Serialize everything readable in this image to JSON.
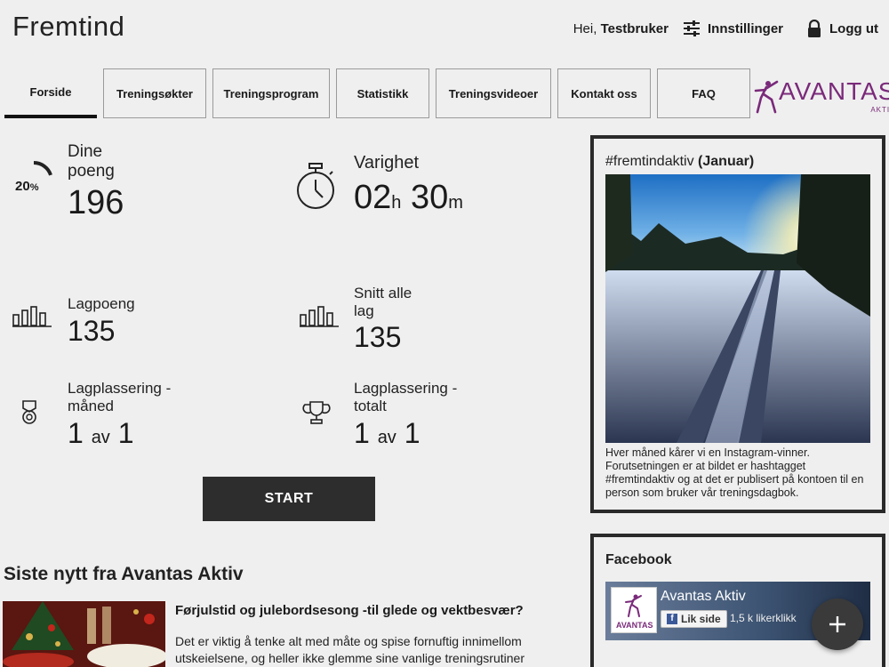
{
  "header": {
    "app_title": "Fremtind",
    "greeting_prefix": "Hei,",
    "user_name": "Testbruker",
    "settings_label": "Innstillinger",
    "logout_label": "Logg ut"
  },
  "nav": {
    "tabs": [
      {
        "label": "Forside",
        "active": true
      },
      {
        "label": "Treningsøkter"
      },
      {
        "label": "Treningsprogram"
      },
      {
        "label": "Statistikk"
      },
      {
        "label": "Treningsvideoer"
      },
      {
        "label": "Kontakt oss"
      },
      {
        "label": "FAQ"
      }
    ],
    "logo_text": "AVANTAS",
    "logo_subtext": "AKTIV"
  },
  "stats": {
    "points": {
      "label_line1": "Dine",
      "label_line2": "poeng",
      "value": "196",
      "progress_text": "20",
      "progress_unit": "%",
      "progress_fraction": 0.2
    },
    "duration": {
      "label": "Varighet",
      "hours": "02",
      "hours_unit": "h",
      "minutes": "30",
      "minutes_unit": "m"
    },
    "team_points": {
      "label": "Lagpoeng",
      "value": "135"
    },
    "avg_all_teams": {
      "label_line1": "Snitt alle",
      "label_line2": "lag",
      "value": "135"
    },
    "rank_month": {
      "label_line1": "Lagplassering -",
      "label_line2": "måned",
      "rank": "1",
      "of": "av",
      "total": "1"
    },
    "rank_total": {
      "label_line1": "Lagplassering -",
      "label_line2": "totalt",
      "rank": "1",
      "of": "av",
      "total": "1"
    }
  },
  "start_button": "START",
  "news": {
    "heading": "Siste nytt fra Avantas Aktiv",
    "items": [
      {
        "title": "Førjulstid og julebordsesong -til glede og vektbesvær?",
        "text_line1": "Det er viktig å tenke alt med måte og spise fornuftig innimellom",
        "text_line2": "utskeielsene, og heller ikke glemme sine vanlige treningsrutiner"
      }
    ]
  },
  "instagram": {
    "title_tag": "#fremtindaktiv",
    "title_month": "(Januar)",
    "caption": "Hver måned kårer vi en Instagram-vinner. Forutsetningen er at bildet er hashtagget #fremtindaktiv og at det er publisert på kontoen til en person som bruker vår treningsdagbok."
  },
  "facebook": {
    "title": "Facebook",
    "page_name": "Avantas Aktiv",
    "like_label": "Lik side",
    "like_count": "1,5 k likerklikk",
    "logo_text": "AVANTAS"
  },
  "colors": {
    "brand_purple": "#7a2a7a",
    "dark": "#2d2d2d",
    "facebook_blue": "#3b5998"
  }
}
